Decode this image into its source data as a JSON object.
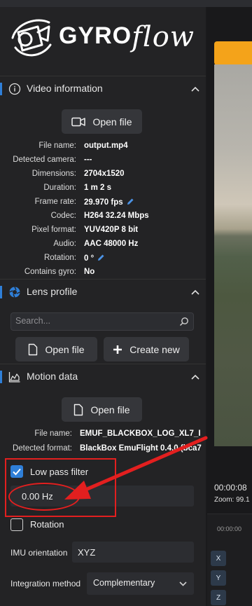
{
  "app": {
    "name_part1": "GYRO",
    "name_part2": "flow"
  },
  "video_info": {
    "title": "Video information",
    "open_button": "Open file",
    "rows": [
      {
        "label": "File name:",
        "value": "output.mp4"
      },
      {
        "label": "Detected camera:",
        "value": "---"
      },
      {
        "label": "Dimensions:",
        "value": "2704x1520"
      },
      {
        "label": "Duration:",
        "value": "1 m 2 s"
      },
      {
        "label": "Frame rate:",
        "value": "29.970 fps"
      },
      {
        "label": "Codec:",
        "value": "H264 32.24 Mbps"
      },
      {
        "label": "Pixel format:",
        "value": "YUV420P 8 bit"
      },
      {
        "label": "Audio:",
        "value": "AAC 48000 Hz"
      },
      {
        "label": "Rotation:",
        "value": "0 °"
      },
      {
        "label": "Contains gyro:",
        "value": "No"
      }
    ]
  },
  "lens_profile": {
    "title": "Lens profile",
    "search_placeholder": "Search...",
    "open_button": "Open file",
    "create_button": "Create new"
  },
  "motion_data": {
    "title": "Motion data",
    "open_button": "Open file",
    "rows": [
      {
        "label": "File name:",
        "value": "EMUF_BLACKBOX_LOG_XL7_I"
      },
      {
        "label": "Detected format:",
        "value": "BlackBox EmuFlight 0.4.0 (bca7"
      }
    ],
    "low_pass_label": "Low pass filter",
    "low_pass_checked": true,
    "low_pass_value": "0.00 Hz",
    "rotation_label": "Rotation",
    "rotation_checked": false,
    "imu_label": "IMU orientation",
    "imu_value": "XYZ",
    "integration_label": "Integration method",
    "integration_value": "Complementary"
  },
  "preview": {
    "time": "00:00:08",
    "zoom": "Zoom: 99.1",
    "tick": "00:00:00",
    "axes": [
      "X",
      "Y",
      "Z"
    ]
  },
  "colors": {
    "accent": "#2f7fd8",
    "annotation": "#e31f1f",
    "orange": "#f4a31a"
  }
}
